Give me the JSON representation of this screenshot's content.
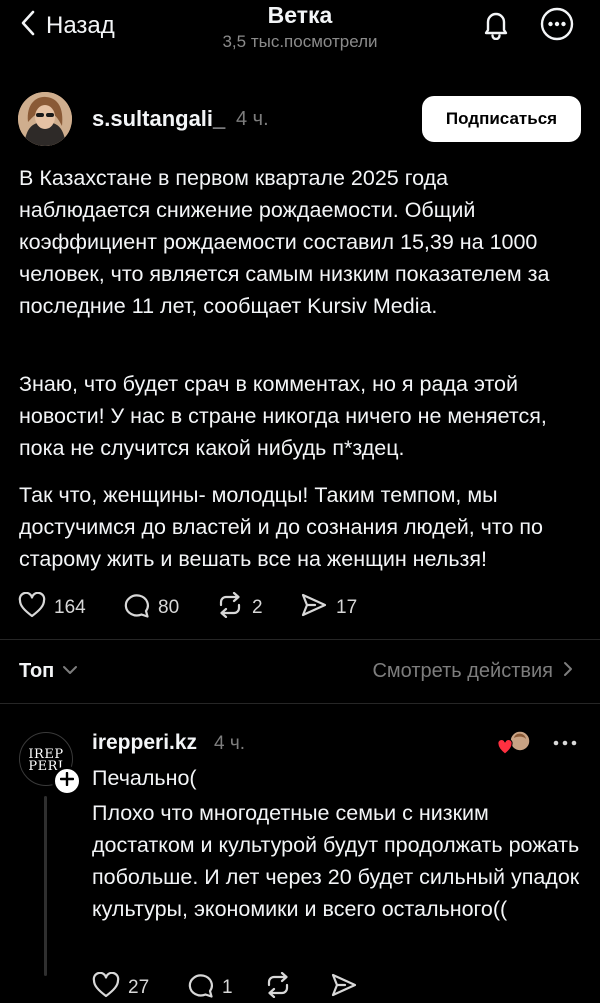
{
  "header": {
    "back_label": "Назад",
    "title": "Ветка",
    "views": "3,5 тыс.посмотрели"
  },
  "post": {
    "username": "s.sultangali_",
    "time": "4 ч.",
    "follow_label": "Подписаться",
    "paragraphs": [
      "В Казахстане в первом квартале 2025 года наблюдается снижение рождаемости. Общий коэффициент рождаемости составил 15,39 на 1000 человек, что является самым низким показателем за последние 11 лет, сообщает Kursiv Media.",
      "Знаю, что будет срач в комментах, но я рада этой новости! У нас в стране никогда ничего не меняется, пока не случится какой нибудь п*здец.",
      "Так что, женщины- молодцы! Таким темпом, мы достучимся до властей и до сознания людей, что по старому жить и вешать все на женщин нельзя!"
    ],
    "likes": "164",
    "comments": "80",
    "reposts": "2",
    "shares": "17"
  },
  "replies_bar": {
    "sort_label": "Топ",
    "activity_label": "Смотреть действия"
  },
  "comment": {
    "avatar_text_line1": "IREP",
    "avatar_text_line2": "PERI",
    "username": "irepperi.kz",
    "time": "4 ч.",
    "paragraphs": [
      "Печально(",
      "Плохо что многодетные семьи с низким достатком и культурой будут продолжать рожать побольше. И лет через 20 будет сильный упадок культуры, экономики и всего остального(("
    ],
    "likes": "27",
    "comments": "1"
  },
  "colors": {
    "background": "#000000",
    "text": "#f3f5f7",
    "muted": "#7d7d7d",
    "like_red": "#ff3040"
  }
}
